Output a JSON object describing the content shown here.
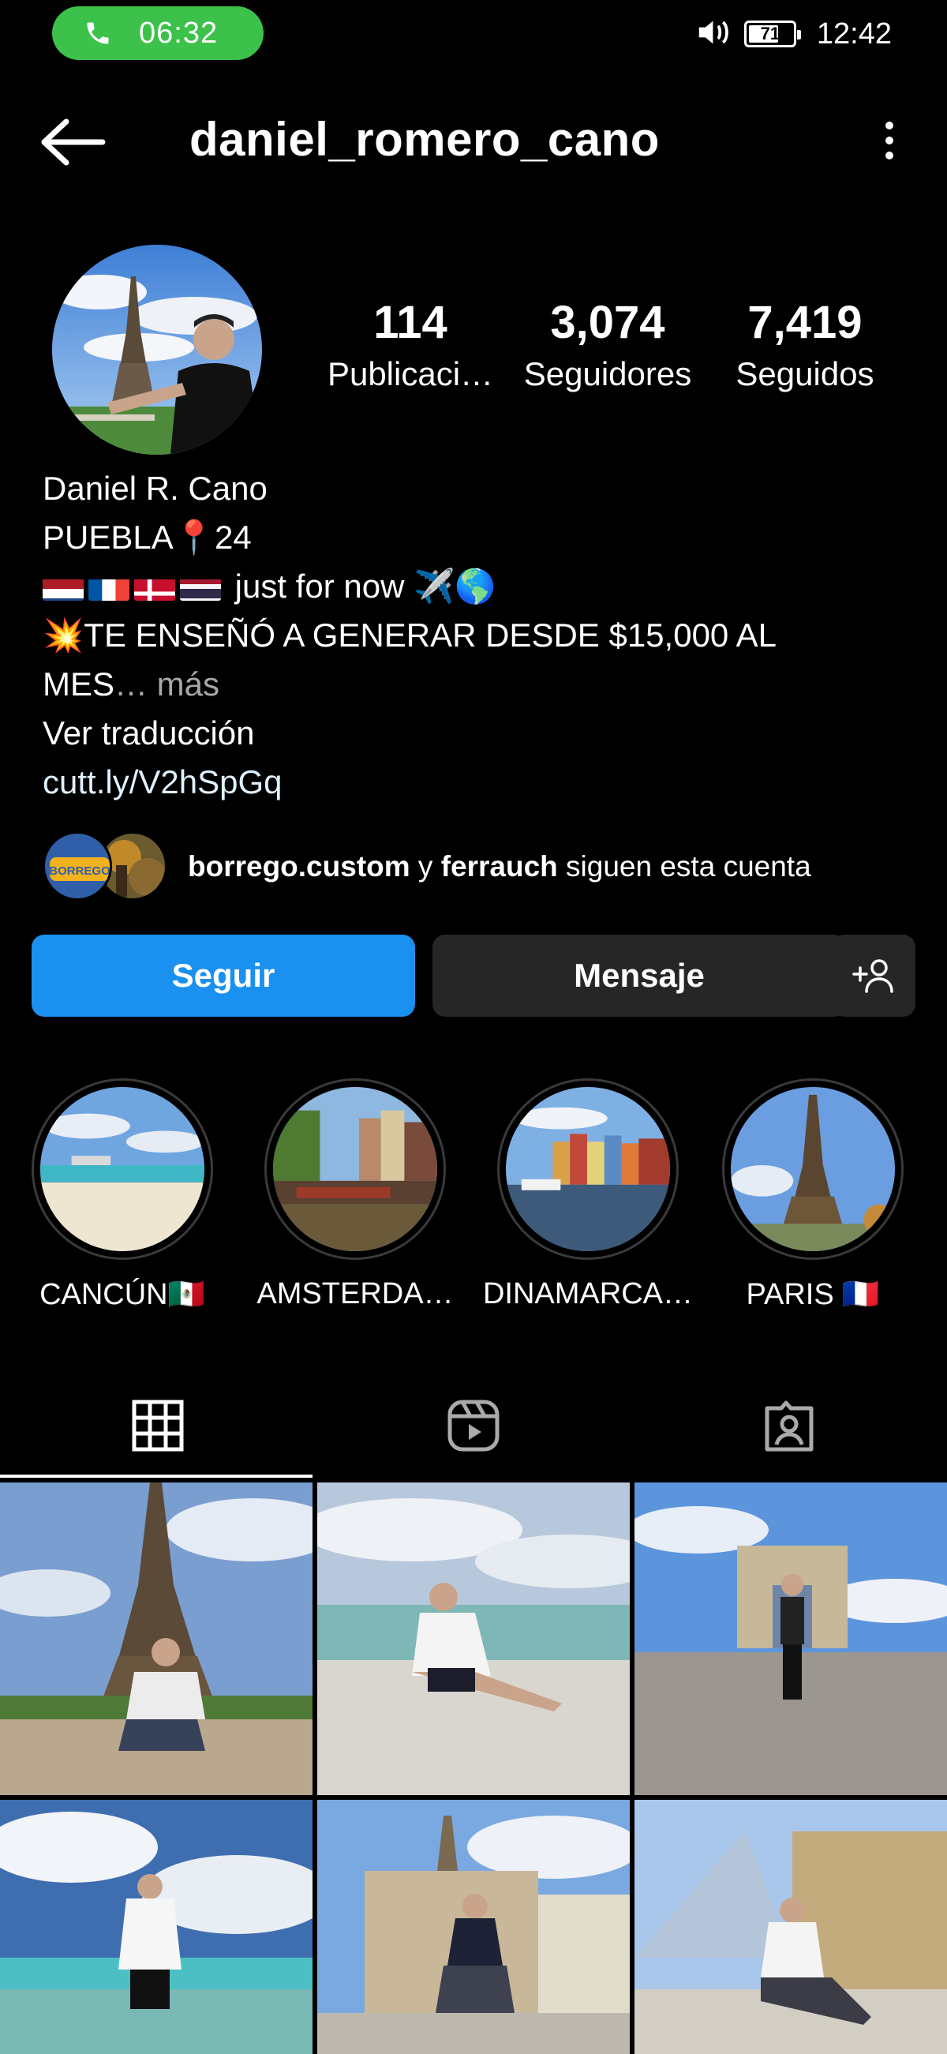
{
  "status_bar": {
    "call_time": "06:32",
    "battery_level": "71",
    "clock": "12:42",
    "icons": [
      "phone-icon",
      "volume-icon",
      "battery-icon"
    ]
  },
  "header": {
    "username": "daniel_romero_cano",
    "icons": [
      "back-arrow-icon",
      "more-vertical-icon"
    ]
  },
  "stats": [
    {
      "value": "114",
      "label": "Publicaci…"
    },
    {
      "value": "3,074",
      "label": "Seguidores"
    },
    {
      "value": "7,419",
      "label": "Seguidos"
    }
  ],
  "bio": {
    "name": "Daniel R. Cano",
    "line2": "PUEBLA📍24",
    "line3_text": " just for now ✈️🌎",
    "line4": "💥TE ENSEÑÓ A GENERAR DESDE $15,000 AL",
    "line5": "MES",
    "more": "… más",
    "translate": "Ver traducción",
    "link": "cutt.ly/V2hSpGq"
  },
  "followed_by": {
    "user1": "borrego.custom",
    "connector": " y ",
    "user2": "ferrauch",
    "suffix": " siguen esta cuenta",
    "badge_text": "BORREGO"
  },
  "actions": {
    "follow": "Seguir",
    "message": "Mensaje",
    "add_icon": "add-person-icon"
  },
  "highlights": [
    {
      "label": "CANCÚN🇲🇽"
    },
    {
      "label": "AMSTERDA…"
    },
    {
      "label": "DINAMARCA…"
    },
    {
      "label": "PARIS 🇫🇷"
    }
  ],
  "tabs": [
    "grid-icon",
    "reels-icon",
    "tagged-icon"
  ],
  "colors": {
    "background": "#000000",
    "follow_button": "#1a90f0",
    "secondary_button": "#262626",
    "call_pill": "#3cc24a",
    "muted_text": "#a8a8a8"
  }
}
